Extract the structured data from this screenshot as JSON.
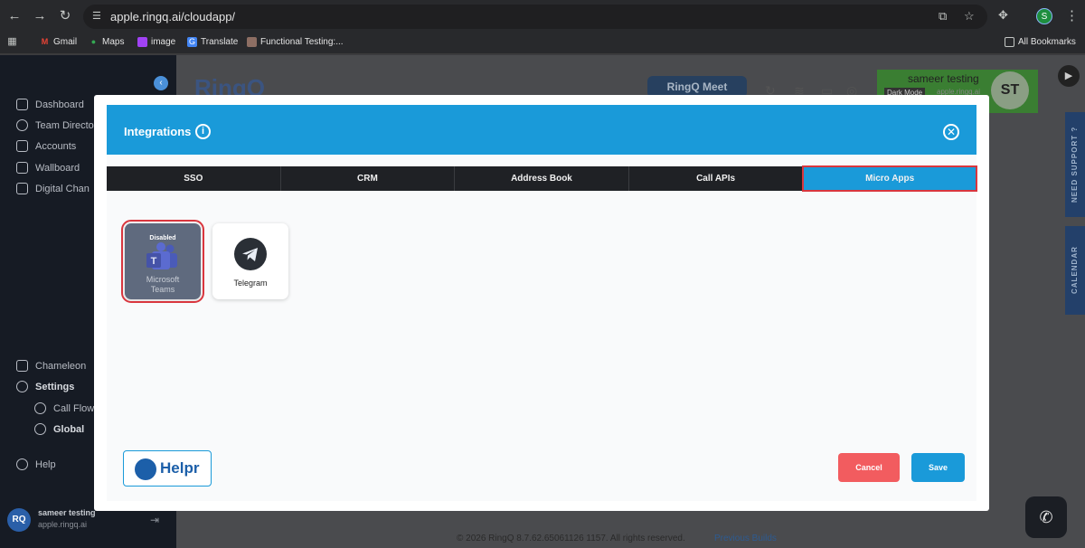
{
  "browser": {
    "url": "apple.ringq.ai/cloudapp/",
    "profile_initial": "S",
    "bookmarks": [
      "Gmail",
      "Maps",
      "image",
      "Translate",
      "Functional Testing:..."
    ],
    "all_bookmarks": "All Bookmarks"
  },
  "sidebar": {
    "items": [
      "Dashboard",
      "Team Directo",
      "Accounts",
      "Wallboard",
      "Digital Chan",
      "Chameleon",
      "Settings",
      "Call Flow",
      "Global",
      "Help"
    ],
    "user": {
      "avatar": "RQ",
      "name": "sameer testing",
      "domain": "apple.ringq.ai"
    }
  },
  "header": {
    "logo": "RingQ",
    "meet_label": "RingQ Meet",
    "user_name": "sameer testing",
    "dark_mode": "Dark Mode",
    "user_domain": "apple.ringq.ai",
    "avatar": "ST"
  },
  "side_tabs": {
    "support": "NEED SUPPORT ?",
    "calendar": "CALENDAR"
  },
  "footer": {
    "copyright": "© 2026 RingQ 8.7.62.65061126 1157. All rights reserved.",
    "previous_builds": "Previous Builds"
  },
  "modal": {
    "title": "Integrations",
    "tabs": [
      "SSO",
      "CRM",
      "Address Book",
      "Call APIs",
      "Micro Apps"
    ],
    "active_tab": "Micro Apps",
    "apps": [
      {
        "name": "Microsoft Teams",
        "line1": "Microsoft",
        "line2": "Teams",
        "badge": "Disabled"
      },
      {
        "name": "Telegram"
      }
    ],
    "helpr": "Helpr",
    "cancel_label": "Cancel",
    "save_label": "Save"
  },
  "colors": {
    "accent": "#1a9ad9",
    "danger": "#f25c5f",
    "tab_dark": "#1f2125",
    "highlight": "#d9363e"
  }
}
